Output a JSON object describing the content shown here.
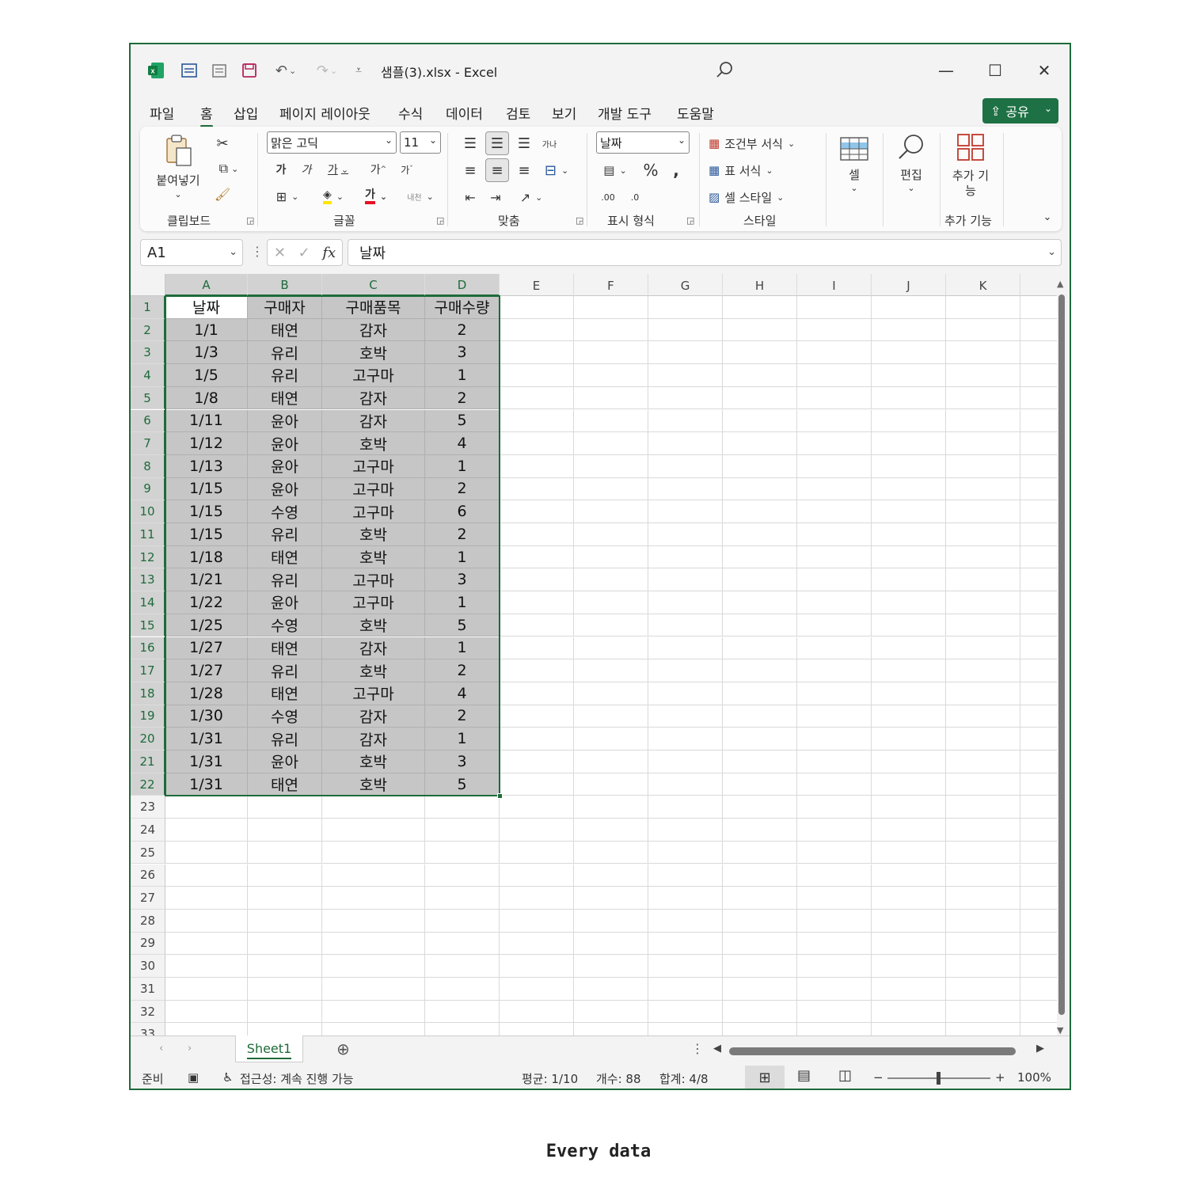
{
  "window": {
    "title": "샘플(3).xlsx  -  Excel",
    "controls": {
      "minimize": "—",
      "maximize": "☐",
      "close": "✕"
    }
  },
  "menu": {
    "tabs": [
      "파일",
      "홈",
      "삽입",
      "페이지 레이아웃",
      "수식",
      "데이터",
      "검토",
      "보기",
      "개발 도구",
      "도움말"
    ],
    "active_tab": "홈",
    "share_label": "공유"
  },
  "ribbon": {
    "clipboard": {
      "paste": "붙여넣기",
      "label": "클립보드"
    },
    "font": {
      "name": "맑은 고딕",
      "size": "11",
      "label": "글꼴"
    },
    "alignment": {
      "label": "맞춤"
    },
    "number": {
      "format": "날짜",
      "label": "표시 형식"
    },
    "styles": {
      "conditional": "조건부 서식",
      "table": "표 서식",
      "cell_style": "셀 스타일",
      "label": "스타일"
    },
    "cells": {
      "label": "셀"
    },
    "editing": {
      "label": "편집"
    },
    "addins": {
      "button": "추가 기능",
      "label": "추가 기능"
    }
  },
  "formula_bar": {
    "name_box": "A1",
    "value": "날짜"
  },
  "columns": [
    "A",
    "B",
    "C",
    "D",
    "E",
    "F",
    "G",
    "H",
    "I",
    "J",
    "K"
  ],
  "table": {
    "headers": [
      "날짜",
      "구매자",
      "구매품목",
      "구매수량"
    ],
    "rows": [
      [
        "1/1",
        "태연",
        "감자",
        "2"
      ],
      [
        "1/3",
        "유리",
        "호박",
        "3"
      ],
      [
        "1/5",
        "유리",
        "고구마",
        "1"
      ],
      [
        "1/8",
        "태연",
        "감자",
        "2"
      ],
      [
        "1/11",
        "윤아",
        "감자",
        "5"
      ],
      [
        "1/12",
        "윤아",
        "호박",
        "4"
      ],
      [
        "1/13",
        "윤아",
        "고구마",
        "1"
      ],
      [
        "1/15",
        "윤아",
        "고구마",
        "2"
      ],
      [
        "1/15",
        "수영",
        "고구마",
        "6"
      ],
      [
        "1/15",
        "유리",
        "호박",
        "2"
      ],
      [
        "1/18",
        "태연",
        "호박",
        "1"
      ],
      [
        "1/21",
        "유리",
        "고구마",
        "3"
      ],
      [
        "1/22",
        "윤아",
        "고구마",
        "1"
      ],
      [
        "1/25",
        "수영",
        "호박",
        "5"
      ],
      [
        "1/27",
        "태연",
        "감자",
        "1"
      ],
      [
        "1/27",
        "유리",
        "호박",
        "2"
      ],
      [
        "1/28",
        "태연",
        "고구마",
        "4"
      ],
      [
        "1/30",
        "수영",
        "감자",
        "2"
      ],
      [
        "1/31",
        "유리",
        "감자",
        "1"
      ],
      [
        "1/31",
        "윤아",
        "호박",
        "3"
      ],
      [
        "1/31",
        "태연",
        "호박",
        "5"
      ]
    ]
  },
  "row_numbers": [
    "1",
    "2",
    "3",
    "4",
    "5",
    "6",
    "7",
    "8",
    "9",
    "10",
    "11",
    "12",
    "13",
    "14",
    "15",
    "16",
    "17",
    "18",
    "19",
    "20",
    "21",
    "22",
    "23",
    "24",
    "25",
    "26",
    "27",
    "28",
    "29",
    "30",
    "31",
    "32",
    "33"
  ],
  "sheet_tabs": [
    "Sheet1"
  ],
  "status": {
    "mode": "준비",
    "accessibility": "접근성: 계속 진행 가능",
    "average": "평균: 1/10",
    "count": "개수: 88",
    "sum": "합계: 4/8",
    "zoom": "100%"
  },
  "caption": "Every data",
  "colors": {
    "accent": "#1e6b3a",
    "share_button": "#1e7145",
    "selection": "#c6c6c6"
  }
}
